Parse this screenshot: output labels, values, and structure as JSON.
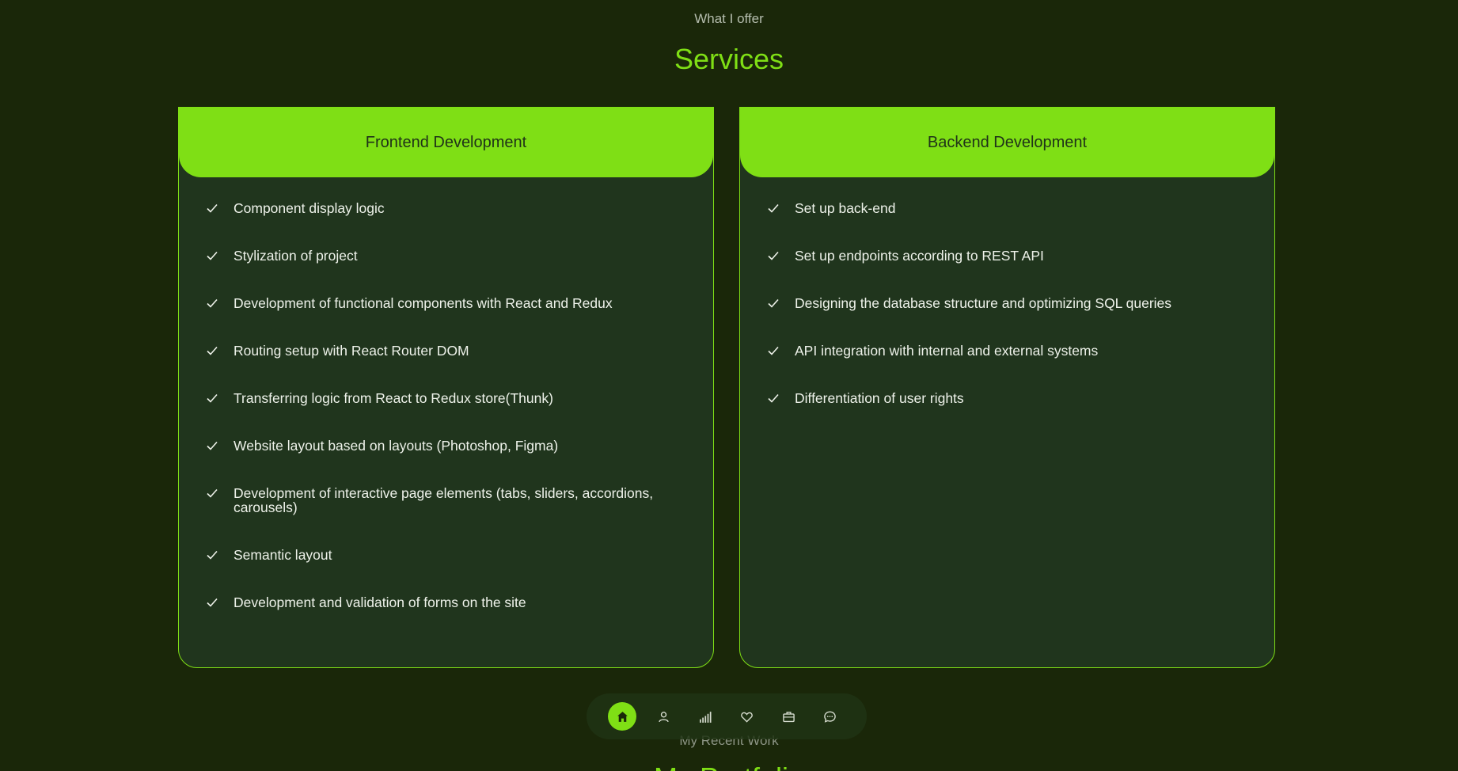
{
  "header": {
    "subtitle": "What I offer",
    "title": "Services"
  },
  "cards": {
    "frontend": {
      "title": "Frontend Development",
      "items": [
        "Component display logic",
        "Stylization of project",
        "Development of functional components with React and Redux",
        "Routing setup with React Router DOM",
        "Transferring logic from React to Redux store(Thunk)",
        "Website layout based on layouts (Photoshop, Figma)",
        "Development of interactive page elements (tabs, sliders, accordions, carousels)",
        "Semantic layout",
        "Development and validation of forms on the site"
      ]
    },
    "backend": {
      "title": "Backend Development",
      "items": [
        "Set up back-end",
        "Set up endpoints according to REST API",
        "Designing the database structure and optimizing SQL queries",
        "API integration with internal and external systems",
        "Differentiation of user rights"
      ]
    }
  },
  "next_section": {
    "subtitle": "My Recent Work",
    "title": "My Portfolio"
  },
  "nav": {
    "items": [
      {
        "icon": "home-icon",
        "active": true
      },
      {
        "icon": "user-icon",
        "active": false
      },
      {
        "icon": "signal-bars-icon",
        "active": false
      },
      {
        "icon": "heart-icon",
        "active": false
      },
      {
        "icon": "briefcase-icon",
        "active": false
      },
      {
        "icon": "chat-icon",
        "active": false
      }
    ]
  },
  "colors": {
    "background": "#1a2709",
    "card_background": "#20351d",
    "accent": "#7fdf15"
  }
}
